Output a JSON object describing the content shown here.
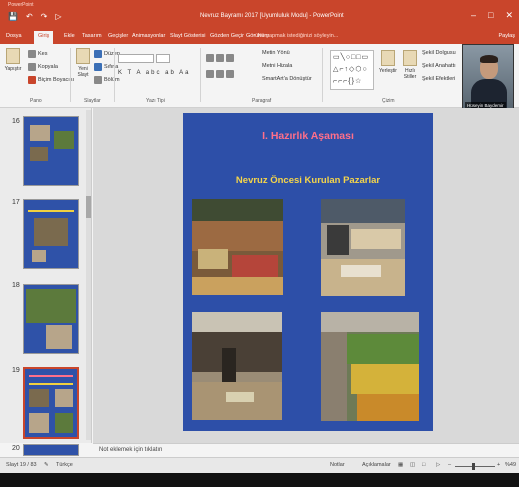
{
  "window": {
    "os_label": "PowerPoint",
    "doc_title": "Nevruz Bayramı 2017 [Uyumluluk Modu] - PowerPoint",
    "qat_icons": [
      "save-icon",
      "undo-icon",
      "redo-icon",
      "present-icon"
    ],
    "controls": [
      "minimize-icon",
      "restore-icon",
      "close-icon"
    ],
    "accent": "#c9452b"
  },
  "tabs": [
    {
      "label": "Dosya"
    },
    {
      "label": "Giriş",
      "active": true
    },
    {
      "label": "Ekle"
    },
    {
      "label": "Tasarım"
    },
    {
      "label": "Geçişler"
    },
    {
      "label": "Animasyonlar"
    },
    {
      "label": "Slayt Gösterisi"
    },
    {
      "label": "Gözden Geçir"
    },
    {
      "label": "Görünüm"
    }
  ],
  "tell_me": "♀ Ne yapmak istediğinizi söyleyin...",
  "share": "Paylaş",
  "ribbon": {
    "paste": "Yapıştır",
    "cut": "Kes",
    "copy": "Kopyala",
    "format_painter": "Biçim Boyacısı",
    "new_slide": "Yeni Slayt",
    "layout": "Düzen",
    "reset": "Sıfırla",
    "section": "Bölüm",
    "text_direction": "Metin Yönü",
    "align_text": "Metni Hizala",
    "smartart": "SmartArt'a Dönüştür",
    "arrange": "Yerleştir",
    "quick_styles": "Hızlı Stiller",
    "shape_fill": "Şekil Dolgusu",
    "shape_outline": "Şekil Anahattı",
    "shape_effects": "Şekil Efektleri",
    "format_buttons": "K T A abc ab Aa",
    "groups": {
      "clipboard": "Pano",
      "slides": "Slaytlar",
      "font": "Yazı Tipi",
      "paragraph": "Paragraf",
      "drawing": "Çizim"
    }
  },
  "webcam": {
    "name": "Hüseyin Baydemir"
  },
  "thumbnails": [
    {
      "number": "16"
    },
    {
      "number": "17"
    },
    {
      "number": "18"
    },
    {
      "number": "19",
      "selected": true
    },
    {
      "number": "20"
    }
  ],
  "slide": {
    "heading": "I. Hazırlık Aşaması",
    "subheading": "Nevruz Öncesi Kurulan Pazarlar",
    "background": "#2d4fa8",
    "heading_color": "#ff6f8a",
    "subheading_color": "#f5d54a"
  },
  "notes_placeholder": "Not eklemek için tıklatın",
  "status": {
    "slide_count": "Slayt 19 / 83",
    "language": "Türkçe",
    "notes": "Notlar",
    "comments": "Açıklamalar",
    "zoom": "%49"
  }
}
